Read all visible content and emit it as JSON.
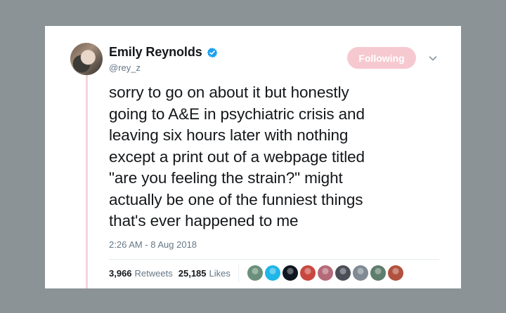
{
  "tweet": {
    "display_name": "Emily Reynolds",
    "handle": "@rey_z",
    "follow_label": "Following",
    "text": "sorry to go on about it but honestly\ngoing to A&E in psychiatric crisis and\nleaving six hours later with nothing\nexcept a print out of a webpage titled\n\"are you feeling the strain?\" might\nactually be one of the funniest things\nthat's ever happened to me",
    "timestamp": "2:26 AM - 8 Aug 2018",
    "retweets_count": "3,966",
    "retweets_label": "Retweets",
    "likes_count": "25,185",
    "likes_label": "Likes"
  },
  "icons": {
    "verified": "verified-badge-icon",
    "more": "chevron-down-icon"
  },
  "colors": {
    "background": "#8c9396",
    "card": "#ffffff",
    "follow_button": "#f6c9d0",
    "verified": "#1da1f2",
    "thread_line": "#f6d5dc",
    "secondary_text": "#657786"
  },
  "likers": [
    {
      "color": "#6a8f7a"
    },
    {
      "color": "#1fb6e8"
    },
    {
      "color": "#0f1620"
    },
    {
      "color": "#c8483f"
    },
    {
      "color": "#b46a78"
    },
    {
      "color": "#4a4f57"
    },
    {
      "color": "#7f8a94"
    },
    {
      "color": "#5e7d6c"
    },
    {
      "color": "#b0523e"
    }
  ]
}
